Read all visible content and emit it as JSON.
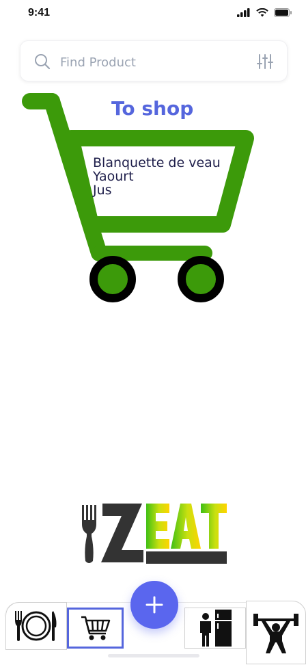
{
  "status": {
    "time": "9:41"
  },
  "search": {
    "placeholder": "Find Product"
  },
  "cart": {
    "title": "To shop",
    "items": [
      "Blanquette de veau",
      "Yaourt",
      "Jus"
    ]
  },
  "logo": {
    "text": "ZEAT"
  },
  "tabs": [
    {
      "icon": "plate-cutlery-icon",
      "active": false
    },
    {
      "icon": "shopping-cart-icon",
      "active": true
    },
    {
      "icon": "fridge-icon",
      "active": false
    },
    {
      "icon": "weightlifter-icon",
      "active": false
    }
  ],
  "colors": {
    "accent": "#5566dd",
    "cart_green": "#3c9a0a",
    "fab": "#5a66ee"
  }
}
